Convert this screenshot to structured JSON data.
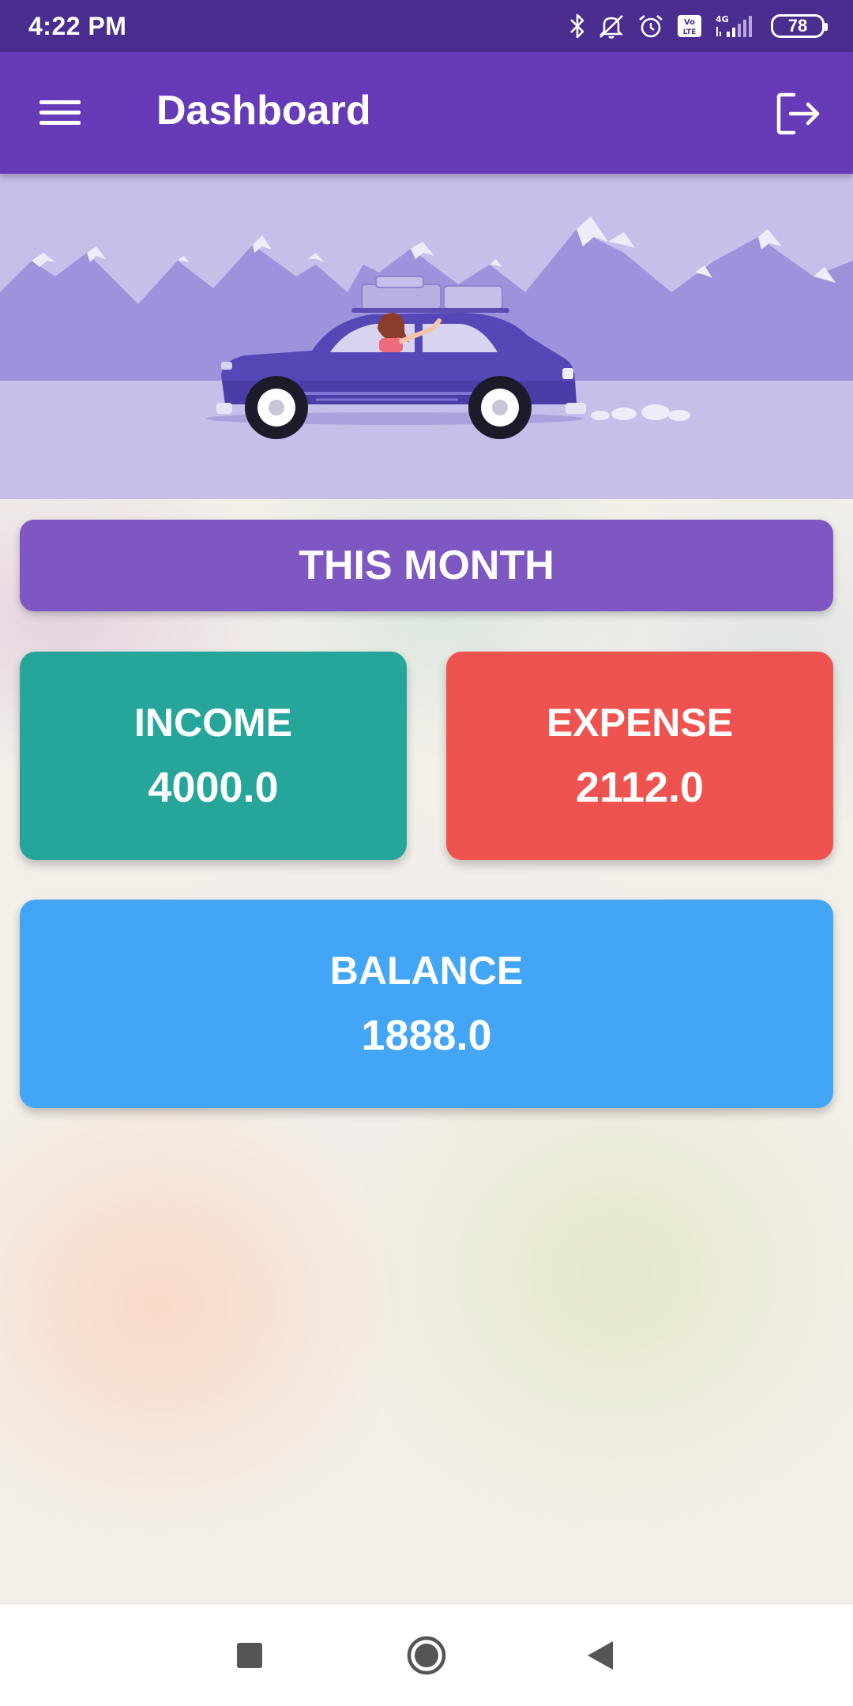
{
  "status_bar": {
    "time": "4:22 PM",
    "battery": "78",
    "network": "4G",
    "icons": [
      "bluetooth-icon",
      "mute-icon",
      "alarm-icon",
      "volte-icon",
      "signal-icon",
      "battery-icon"
    ]
  },
  "app_bar": {
    "title": "Dashboard",
    "menu_icon": "hamburger-menu-icon",
    "logout_icon": "logout-icon",
    "color": "#673ab7"
  },
  "banner": {
    "illustration": "car-trip-illustration"
  },
  "summary": {
    "period_label": "THIS MONTH",
    "income": {
      "label": "INCOME",
      "value": "4000.0",
      "color": "#26a69a"
    },
    "expense": {
      "label": "EXPENSE",
      "value": "2112.0",
      "color": "#ef5350"
    },
    "balance": {
      "label": "BALANCE",
      "value": "1888.0",
      "color": "#42a5f5"
    }
  },
  "nav_bar": {
    "icons": [
      "recent-apps-icon",
      "home-icon",
      "back-icon"
    ]
  }
}
